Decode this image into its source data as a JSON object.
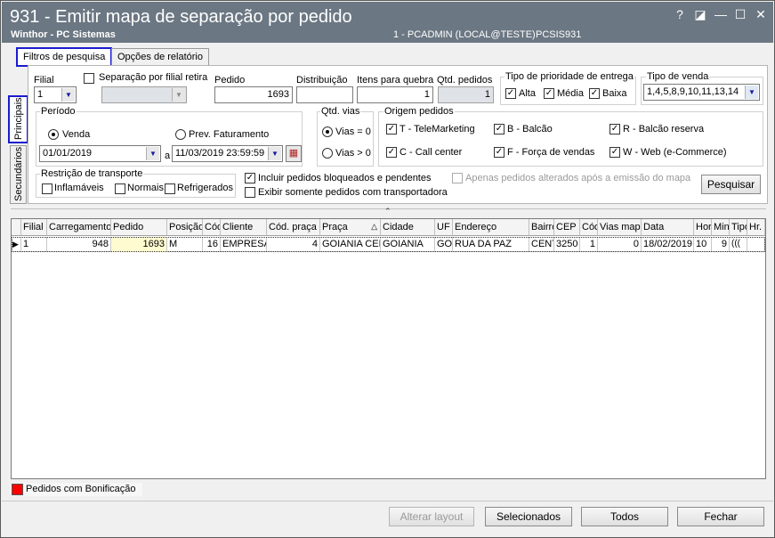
{
  "window": {
    "title": "931 - Emitir mapa de separação por pedido",
    "subtitle": "Winthor - PC Sistemas",
    "user_info": "1 - PCADMIN (LOCAL@TESTE)",
    "module": "PCSIS931",
    "buttons": [
      "?",
      "◪",
      "—",
      "☐",
      "✕"
    ]
  },
  "tabs": [
    "Filtros de pesquisa",
    "Opções de relatório"
  ],
  "side_tabs": [
    "Principais",
    "Secundários"
  ],
  "filters": {
    "filial_label": "Filial",
    "filial_value": "1",
    "separacao_label": "Separação por filial retira",
    "separacao_checked": false,
    "separacao_value": "",
    "pedido_label": "Pedido",
    "pedido_value": "1693",
    "distribuicao_label": "Distribuição",
    "distribuicao_value": "",
    "itens_label": "Itens para quebra",
    "itens_value": "1",
    "qtd_pedidos_label": "Qtd. pedidos",
    "qtd_pedidos_value": "1",
    "prioridade_label": "Tipo de prioridade de  entrega",
    "prioridade": [
      {
        "label": "Alta",
        "checked": true
      },
      {
        "label": "Média",
        "checked": true
      },
      {
        "label": "Baixa",
        "checked": true
      }
    ],
    "tipo_venda_label": "Tipo de venda",
    "tipo_venda_value": "1,4,5,8,9,10,11,13,14",
    "periodo_label": "Período",
    "periodo_venda": "Venda",
    "periodo_prev": "Prev. Faturamento",
    "periodo_selected": "Venda",
    "date_from": "01/01/2019",
    "date_sep": "a",
    "date_to": "11/03/2019 23:59:59",
    "qtd_vias_label": "Qtd. vias",
    "vias_0": "Vias = 0",
    "vias_gt0": "Vias > 0",
    "vias_selected": "Vias = 0",
    "origem_label": "Origem pedidos",
    "origem": [
      {
        "label": "T - TeleMarketing",
        "checked": true
      },
      {
        "label": "B - Balcão",
        "checked": true
      },
      {
        "label": "R - Balcão reserva",
        "checked": true
      },
      {
        "label": "C - Call center",
        "checked": true
      },
      {
        "label": "F - Força de vendas",
        "checked": true
      },
      {
        "label": "W - Web (e-Commerce)",
        "checked": true
      }
    ],
    "restricao_label": "Restrição de transporte",
    "restricao": [
      {
        "label": "Inflamáveis",
        "checked": false
      },
      {
        "label": "Normais",
        "checked": false
      },
      {
        "label": "Refrigerados",
        "checked": false
      }
    ],
    "incluir_bloqueados": "Incluir pedidos bloqueados e pendentes",
    "incluir_bloqueados_checked": true,
    "exibir_transportadora": "Exibir somente pedidos com transportadora",
    "exibir_transportadora_checked": false,
    "apenas_alterados": "Apenas pedidos alterados após a emissão do mapa",
    "apenas_alterados_checked": false,
    "pesquisar": "Pesquisar"
  },
  "grid": {
    "columns": [
      "Filial",
      "Carregamento",
      "Pedido",
      "Posição",
      "Cód",
      "Cliente",
      "Cód. praça",
      "Praça",
      "Cidade",
      "UF",
      "Endereço",
      "Bairro",
      "CEP",
      "Cód",
      "Vias mapa",
      "Data",
      "Hora",
      "Min",
      "Tipo",
      "Hr."
    ],
    "rows": [
      [
        "1",
        "948",
        "1693",
        "M",
        "16",
        "EMPRESA",
        "4",
        "GOIANIA CENTRO",
        "GOIANIA",
        "GO",
        "RUA DA PAZ",
        "CENTRO",
        "3250",
        "1",
        "0",
        "18/02/2019",
        "10",
        "9",
        "",
        ""
      ]
    ]
  },
  "legend": {
    "bonificacao_label": "Pedidos com Bonificação",
    "bonificacao_color": "#ff0000"
  },
  "footer": {
    "alterar_layout": "Alterar layout",
    "selecionados": "Selecionados",
    "todos": "Todos",
    "fechar": "Fechar"
  }
}
